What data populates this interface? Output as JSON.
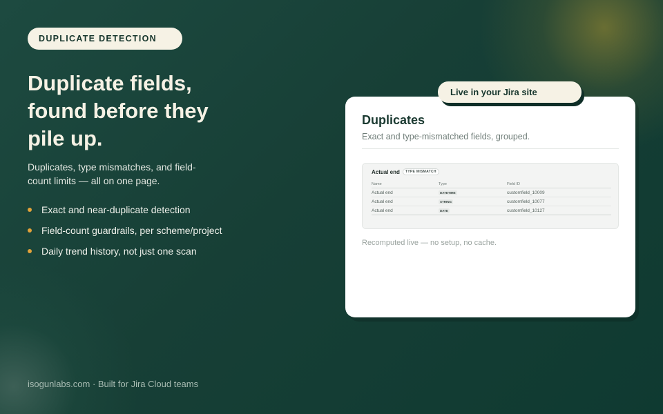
{
  "eyebrow": "DUPLICATE DETECTION",
  "headline": "Duplicate fields, found before they pile up.",
  "subtitle": "Duplicates, type mismatches, and field-count limits — all on one page.",
  "bullets": [
    "Exact and near-duplicate detection",
    "Field-count guardrails, per scheme/project",
    "Daily trend history, not just one scan"
  ],
  "footer": "isogunlabs.com · Built for Jira Cloud teams",
  "colors": {
    "accent": "#e2a23a",
    "cream": "#f6f2e5",
    "background": "#173f36"
  },
  "card": {
    "live_tag": "Live in your Jira site",
    "title": "Duplicates",
    "subtitle": "Exact and type-mismatched fields, grouped.",
    "group": {
      "title": "Actual end",
      "badge": "TYPE MISMATCH",
      "columns": [
        "Name",
        "Type",
        "Field ID"
      ],
      "rows": [
        {
          "name": "Actual end",
          "type": "DATETIME",
          "field_id": "customfield_10009"
        },
        {
          "name": "Actual end",
          "type": "STRING",
          "field_id": "customfield_10077"
        },
        {
          "name": "Actual end",
          "type": "DATE",
          "field_id": "customfield_10127"
        }
      ]
    },
    "footnote": "Recomputed live — no setup, no cache."
  }
}
